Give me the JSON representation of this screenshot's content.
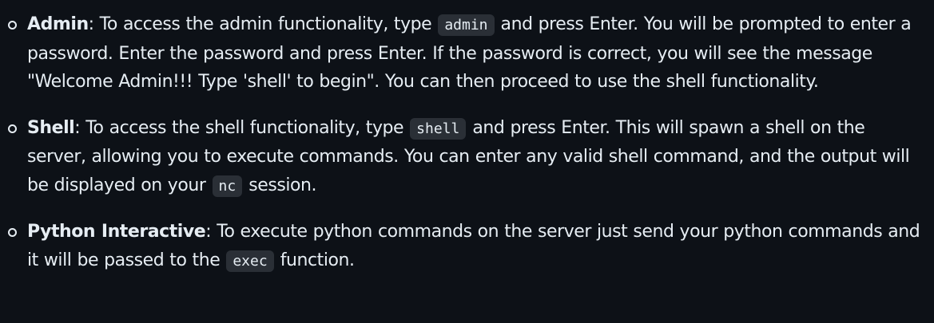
{
  "items": [
    {
      "term": "Admin",
      "text1": ": To access the admin functionality, type ",
      "code1": "admin",
      "text2": " and press Enter. You will be prompted to enter a password. Enter the password and press Enter. If the password is correct, you will see the message \"Welcome Admin!!! Type 'shell' to begin\". You can then proceed to use the shell functionality."
    },
    {
      "term": "Shell",
      "text1": ": To access the shell functionality, type ",
      "code1": "shell",
      "text2": " and press Enter. This will spawn a shell on the server, allowing you to execute commands. You can enter any valid shell command, and the output will be displayed on your ",
      "code2": "nc",
      "text3": " session."
    },
    {
      "term": "Python Interactive",
      "text1": ": To execute python commands on the server just send your python commands and it will be passed to the ",
      "code1": "exec",
      "text2": " function."
    }
  ]
}
